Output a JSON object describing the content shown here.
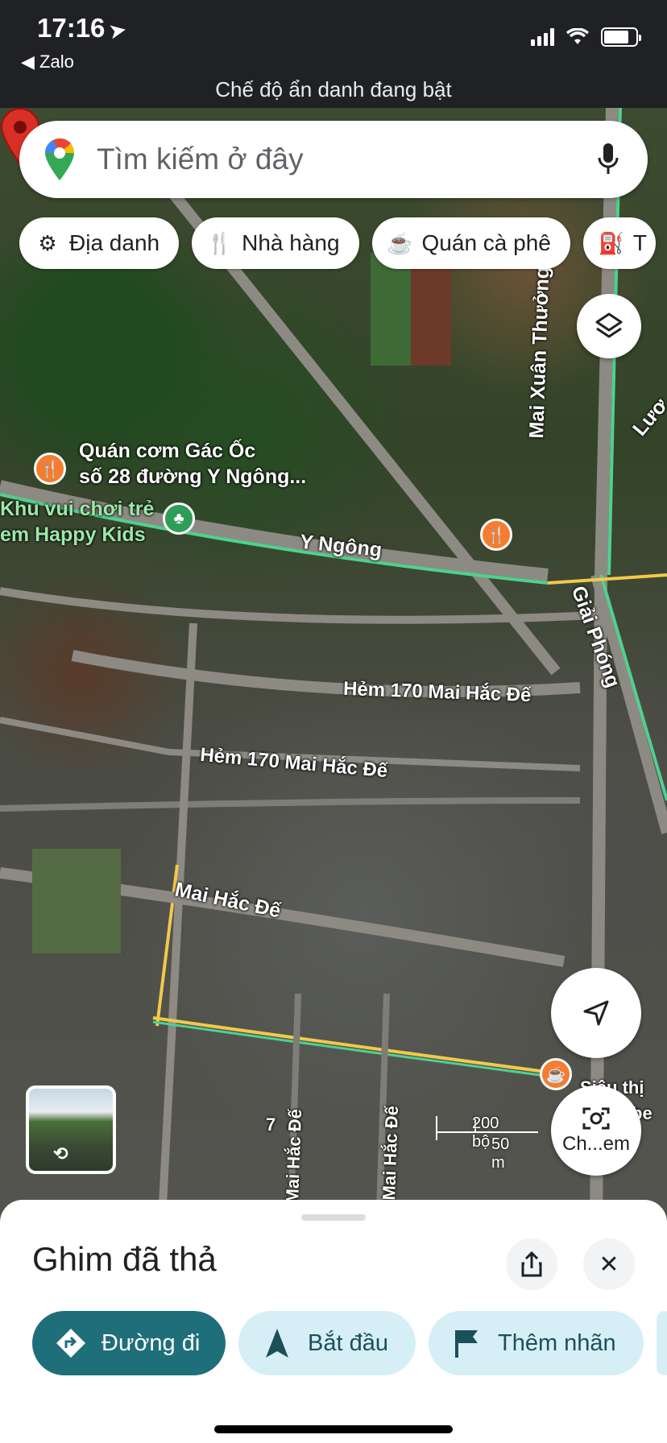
{
  "status": {
    "time": "17:16",
    "back_label": "◀ Zalo",
    "incognito_text": "Chế độ ẩn danh đang bật"
  },
  "search": {
    "placeholder": "Tìm kiếm ở đây"
  },
  "chips": [
    {
      "label": "Địa danh",
      "icon": "landmark-icon"
    },
    {
      "label": "Nhà hàng",
      "icon": "restaurant-icon"
    },
    {
      "label": "Quán cà phê",
      "icon": "coffee-icon"
    },
    {
      "label": "T",
      "icon": "fuel-icon"
    }
  ],
  "map": {
    "labels": {
      "poi1": "Quán cơm Gác Ốc",
      "poi1_sub": "số 28 đường Y Ngông...",
      "poi2": "Khu vui chơi trẻ",
      "poi2_sub": "em Happy Kids",
      "road_yngong": "Y Ngông",
      "road_mxt": "Mai Xuân Thưởng",
      "road_gp": "Giải Phóng",
      "road_luo": "Lươ",
      "alley1": "Hẻm 170 Mai Hắc Đế",
      "alley2": "Hẻm 170 Mai Hắc Đế",
      "road_mhd": "Mai Hắc Đế",
      "road_mhd2": "Mai Hắc Đế",
      "road_mhd3": "Mai Hắc Đế",
      "road_7": "7",
      "sieu": "Siêu thị",
      "be": "be"
    },
    "scale": {
      "top": "200 bộ",
      "bottom": "50 m"
    }
  },
  "lens_label": "Ch...em",
  "sheet": {
    "title": "Ghim đã thả",
    "actions": [
      {
        "label": "Đường đi",
        "icon": "directions-icon"
      },
      {
        "label": "Bắt đầu",
        "icon": "navigation-arrow-icon"
      },
      {
        "label": "Thêm nhãn",
        "icon": "flag-icon"
      }
    ]
  },
  "colors": {
    "primary_button": "#1f6f7a",
    "secondary_button": "#d6eff6",
    "pin": "#d93025",
    "road_green": "#4fd18f",
    "road_yellow": "#f2c94c"
  }
}
